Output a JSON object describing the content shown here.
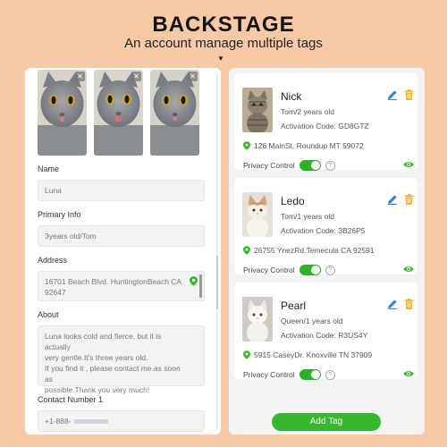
{
  "header": {
    "title": "BACKSTAGE",
    "subtitle": "An account manage multiple tags"
  },
  "left_panel": {
    "photos": [
      {
        "icon": "cat-photo"
      },
      {
        "icon": "cat-photo"
      },
      {
        "icon": "cat-photo"
      }
    ],
    "name_label": "Name",
    "name_value": "Luna",
    "primary_info_label": "Primary Info",
    "primary_info_value": "3years old/Tom",
    "address_label": "Address",
    "address_value_1": "16701 Beach Blvd. HuntingtonBeach CA",
    "address_value_2": "92647",
    "about_label": "About",
    "about_lines": [
      "Luna looks cold and fierce, but it is actually",
      "very gentle.It's three years old.",
      "If you find it , please contact me as soon as",
      "possible.Thank you very much!"
    ],
    "contact_label": "Contact Number 1",
    "contact_value": "+1-888-"
  },
  "right_panel": {
    "privacy_label": "Privacy Control",
    "add_tag_label": "Add Tag",
    "cards": [
      {
        "name": "Nick",
        "info": "Tom/2 years old",
        "code": "Activation Code: GD8GTZ",
        "address": "126 MainSt. Roundup MT 59072"
      },
      {
        "name": "Ledo",
        "info": "Tom/1 years old",
        "code": "Activation Code: 3B26P5",
        "address": "26755 YnezRd.Temecula CA 92591"
      },
      {
        "name": "Pearl",
        "info": "Queen/1 years old",
        "code": "Activation Code: R3US4Y",
        "address": "5915 CaseyDr. Knoxville TN 37909"
      }
    ]
  },
  "colors": {
    "background": "#f8c9a6",
    "accent_green": "#37b82c",
    "edit_blue": "#2a86c9",
    "trash_yellow": "#f2b630"
  }
}
